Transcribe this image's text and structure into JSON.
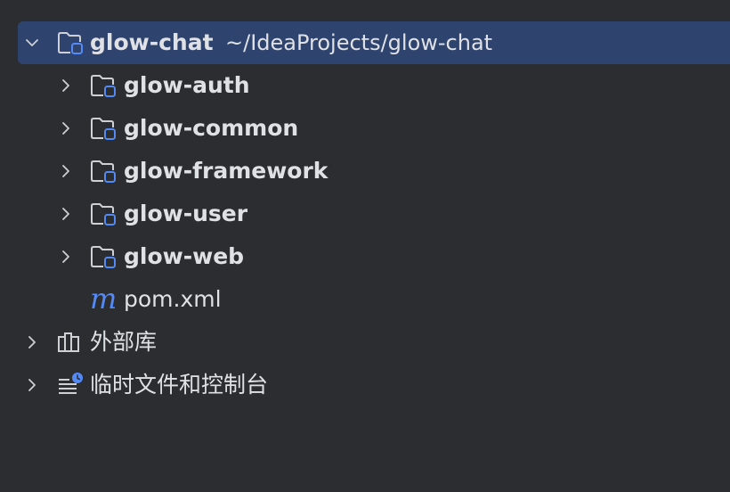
{
  "project_tree": {
    "root": {
      "name": "glow-chat",
      "path": "~/IdeaProjects/glow-chat",
      "expanded": true,
      "icon": "module-folder-icon"
    },
    "modules": [
      {
        "name": "glow-auth",
        "icon": "module-folder-icon"
      },
      {
        "name": "glow-common",
        "icon": "module-folder-icon"
      },
      {
        "name": "glow-framework",
        "icon": "module-folder-icon"
      },
      {
        "name": "glow-user",
        "icon": "module-folder-icon"
      },
      {
        "name": "glow-web",
        "icon": "module-folder-icon"
      }
    ],
    "pom_file": {
      "icon_glyph": "m",
      "name": "pom.xml",
      "icon": "maven-icon"
    },
    "external_libraries": {
      "name": "外部库",
      "icon": "library-icon"
    },
    "scratches": {
      "name": "临时文件和控制台",
      "icon": "scratches-icon"
    }
  },
  "colors": {
    "background": "#2b2d30",
    "selection": "#2e436e",
    "text": "#dfe1e5",
    "accent_blue": "#548af7",
    "icon_gray": "#ced0d6"
  }
}
